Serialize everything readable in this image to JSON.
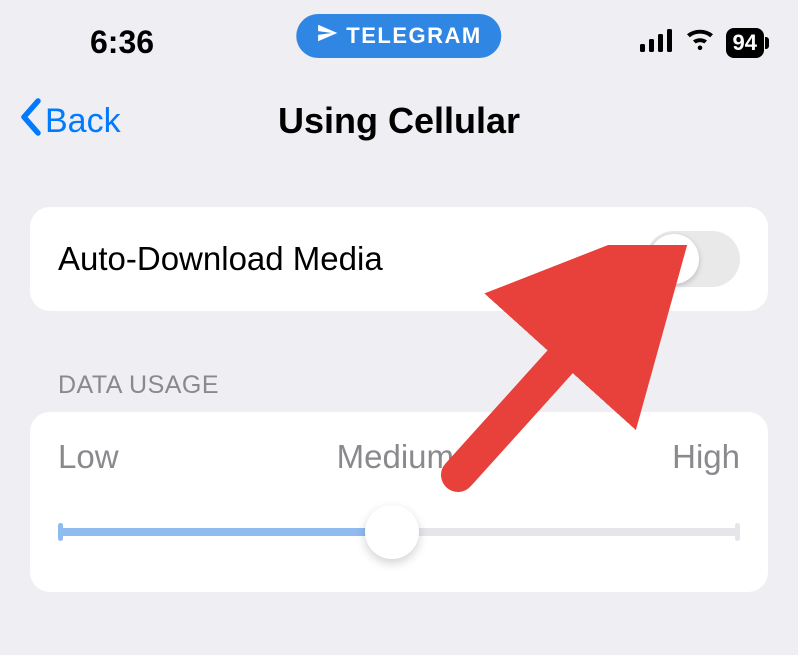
{
  "status_bar": {
    "time": "6:36",
    "app_pill": {
      "label": "TELEGRAM",
      "icon": "paper-plane-icon"
    },
    "battery_percent": "94"
  },
  "nav": {
    "back_label": "Back",
    "title": "Using Cellular"
  },
  "settings": {
    "auto_download_label": "Auto-Download Media",
    "auto_download_on": false
  },
  "data_usage": {
    "section_label": "DATA USAGE",
    "low_label": "Low",
    "medium_label": "Medium",
    "high_label": "High",
    "slider_value": "medium"
  },
  "colors": {
    "accent_blue": "#007aff",
    "pill_blue": "#2f87e3",
    "slider_fill": "#8fbbf0",
    "arrow_red": "#e8403a"
  }
}
